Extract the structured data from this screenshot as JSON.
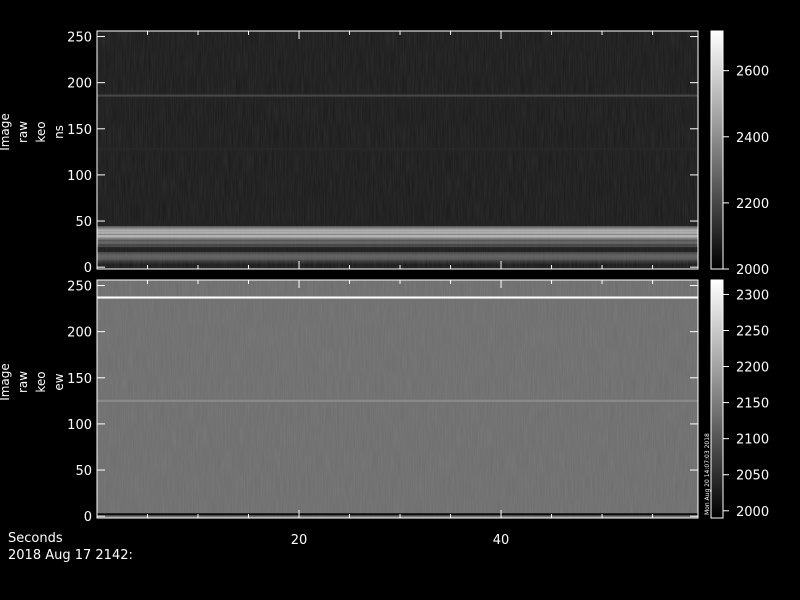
{
  "footer": {
    "xaxis_title": "Seconds",
    "date": "2018 Aug 17 2142:"
  },
  "chart_data": [
    {
      "type": "heatmap",
      "ylabel": [
        "Image",
        "raw",
        "keo",
        "ns"
      ],
      "x_ticks": [
        20,
        40
      ],
      "xlim": [
        0,
        59.5
      ],
      "y_ticks": [
        0,
        50,
        100,
        150,
        200,
        250
      ],
      "ylim": [
        -2,
        256
      ],
      "colorbar": {
        "ticks": [
          2000,
          2200,
          2400,
          2600
        ],
        "range": [
          2000,
          2720
        ]
      },
      "background_level": 2070,
      "bands": [
        {
          "y": 186,
          "level": 2200
        },
        {
          "y": 128,
          "level": 2110
        },
        {
          "y": 40,
          "level": 2500
        },
        {
          "y": 34,
          "level": 2560
        },
        {
          "y": 26,
          "level": 2300
        },
        {
          "y": 12,
          "level": 2280
        }
      ],
      "annotation": ""
    },
    {
      "type": "heatmap",
      "ylabel": [
        "Image",
        "raw",
        "keo",
        "ew"
      ],
      "x_ticks": [
        20,
        40
      ],
      "xlim": [
        0,
        59.5
      ],
      "y_ticks": [
        0,
        50,
        100,
        150,
        200,
        250
      ],
      "ylim": [
        -2,
        256
      ],
      "colorbar": {
        "ticks": [
          2000,
          2050,
          2100,
          2150,
          2200,
          2250,
          2300
        ],
        "range": [
          1990,
          2320
        ]
      },
      "background_level": 2130,
      "bands": [
        {
          "y": 237,
          "level": 2320
        },
        {
          "y": 125,
          "level": 2170
        },
        {
          "y": 2,
          "level": 2000
        }
      ],
      "annotation": "Mon Aug 20 14:07:03 2018"
    }
  ]
}
